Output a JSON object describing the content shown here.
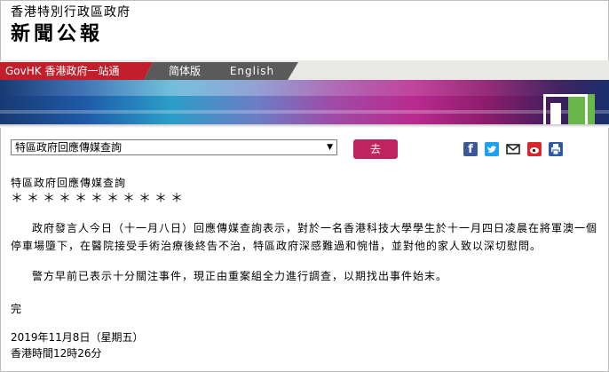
{
  "header": {
    "org_name": "香港特別行政區政府",
    "site_title": "新聞公報"
  },
  "nav": {
    "govhk": "GovHK 香港政府一站通",
    "simplified": "简体版",
    "english": "English"
  },
  "toolbar": {
    "select_value": "特區政府回應傳媒查詢",
    "go_label": "去",
    "share_icons": [
      "facebook-icon",
      "twitter-icon",
      "email-icon",
      "weibo-icon",
      "print-icon"
    ]
  },
  "article": {
    "section_title": "特區政府回應傳媒查詢",
    "separator": "＊＊＊＊＊＊＊＊＊＊＊",
    "paragraph1": "政府發言人今日（十一月八日）回應傳媒查詢表示，對於一名香港科技大學學生於十一月四日凌晨在將軍澳一個停車場墮下，在醫院接受手術治療後終告不治，特區政府深感難過和惋惜，並對他的家人致以深切慰問。",
    "paragraph2": "警方早前已表示十分關注事件，現正由重案組全力進行調查，以期找出事件始末。",
    "end_mark": "完",
    "date": "2019年11月8日（星期五）",
    "time": "香港時間12時26分"
  },
  "colors": {
    "govhk_red": "#c21f2c",
    "nav_grey": "#5a5a5a",
    "go_button": "#c0245f"
  }
}
